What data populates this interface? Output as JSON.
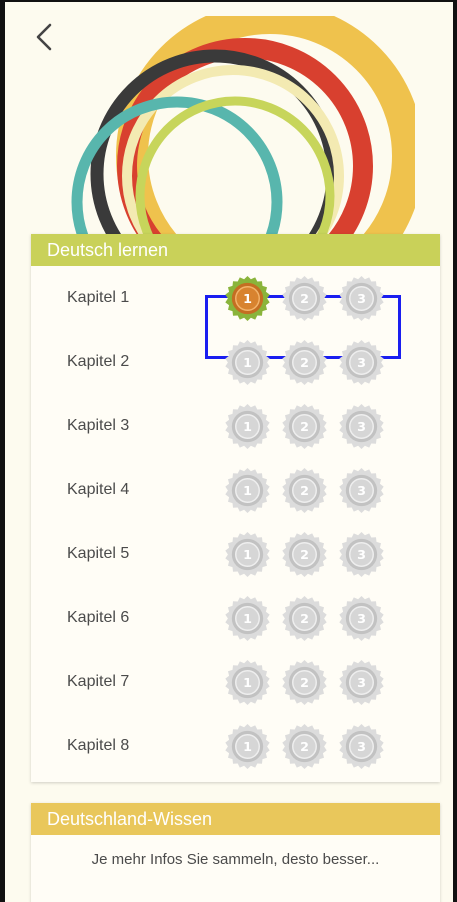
{
  "nav": {
    "back_icon": "chevron-left-icon"
  },
  "header_graphic": {
    "colors": [
      "#efc24d",
      "#d8402f",
      "#3a3a3a",
      "#f3eab2",
      "#58b6ad",
      "#c7d55b"
    ]
  },
  "section_learn": {
    "title": "Deutsch lernen",
    "header_color": "#c9d159",
    "chapters": [
      {
        "label": "Kapitel 1",
        "medals": [
          "1",
          "2",
          "3"
        ],
        "earned": [
          true,
          false,
          false
        ]
      },
      {
        "label": "Kapitel 2",
        "medals": [
          "1",
          "2",
          "3"
        ],
        "earned": [
          false,
          false,
          false
        ]
      },
      {
        "label": "Kapitel 3",
        "medals": [
          "1",
          "2",
          "3"
        ],
        "earned": [
          false,
          false,
          false
        ]
      },
      {
        "label": "Kapitel 4",
        "medals": [
          "1",
          "2",
          "3"
        ],
        "earned": [
          false,
          false,
          false
        ]
      },
      {
        "label": "Kapitel 5",
        "medals": [
          "1",
          "2",
          "3"
        ],
        "earned": [
          false,
          false,
          false
        ]
      },
      {
        "label": "Kapitel 6",
        "medals": [
          "1",
          "2",
          "3"
        ],
        "earned": [
          false,
          false,
          false
        ]
      },
      {
        "label": "Kapitel 7",
        "medals": [
          "1",
          "2",
          "3"
        ],
        "earned": [
          false,
          false,
          false
        ]
      },
      {
        "label": "Kapitel 8",
        "medals": [
          "1",
          "2",
          "3"
        ],
        "earned": [
          false,
          false,
          false
        ]
      }
    ]
  },
  "section_knowledge": {
    "title": "Deutschland-Wissen",
    "header_color": "#e9c75b",
    "description": "Je mehr Infos Sie sammeln, desto besser..."
  },
  "colors": {
    "background": "#fdfbef",
    "medal_earned": "#d8832f",
    "medal_earned_rim": "#8ab43b",
    "medal_locked": "#cfcfcf",
    "highlight": "#1a1ef0"
  }
}
